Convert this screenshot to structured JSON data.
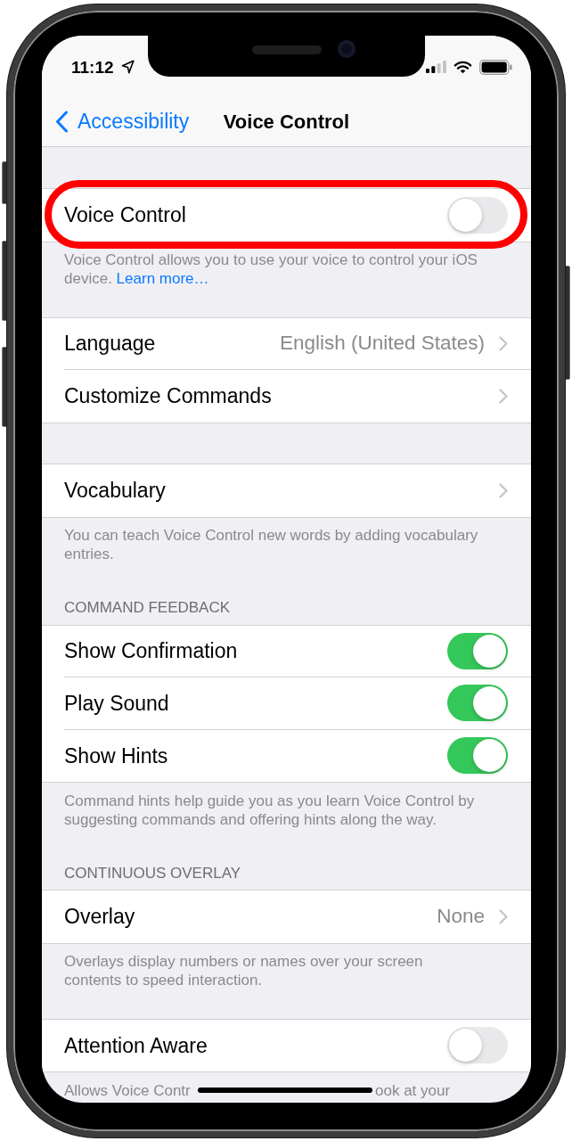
{
  "status_bar": {
    "time": "11:12"
  },
  "nav_bar": {
    "back_label": "Accessibility",
    "title": "Voice Control"
  },
  "sections": [
    {
      "rows": [
        {
          "kind": "toggle",
          "label": "Voice Control",
          "on": false,
          "highlighted": true
        }
      ],
      "footer": {
        "text": "Voice Control allows you to use your voice to control your iOS device.",
        "link": "Learn more…"
      }
    },
    {
      "rows": [
        {
          "kind": "link",
          "label": "Language",
          "value": "English (United States)",
          "highlighted": false
        },
        {
          "kind": "link",
          "label": "Customize Commands",
          "highlighted": false
        }
      ]
    },
    {
      "rows": [
        {
          "kind": "link",
          "label": "Vocabulary",
          "highlighted": false
        }
      ],
      "footer": {
        "text": "You can teach Voice Control new words by adding vocabulary entries."
      }
    },
    {
      "header": "COMMAND FEEDBACK",
      "rows": [
        {
          "kind": "toggle",
          "label": "Show Confirmation",
          "on": true,
          "highlighted": false
        },
        {
          "kind": "toggle",
          "label": "Play Sound",
          "on": true,
          "highlighted": false
        },
        {
          "kind": "toggle",
          "label": "Show Hints",
          "on": true,
          "highlighted": false
        }
      ],
      "footer": {
        "text": "Command hints help guide you as you learn Voice Control by suggesting commands and offering hints along the way."
      }
    },
    {
      "header": "CONTINUOUS OVERLAY",
      "rows": [
        {
          "kind": "link",
          "label": "Overlay",
          "value": "None",
          "highlighted": false
        }
      ],
      "footer": {
        "text": "Overlays display numbers or names over your screen contents to speed interaction."
      }
    },
    {
      "rows": [
        {
          "kind": "toggle",
          "label": "Attention Aware",
          "on": false,
          "highlighted": false
        }
      ],
      "footer": {
        "visible_parts": [
          "Allows Voice Contr",
          "ook at your"
        ]
      }
    }
  ]
}
